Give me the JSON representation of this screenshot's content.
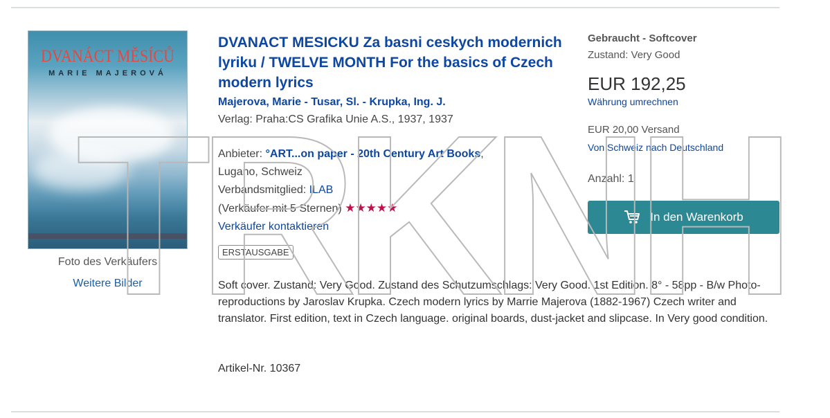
{
  "listing": {
    "cover": {
      "title_text": "DVANÁCT MĚSÍCŮ",
      "author_text": "MARIE MAJEROVÁ"
    },
    "photo_caption": "Foto des Verkäufers",
    "more_images": "Weitere Bilder",
    "title": "DVANACT MESICKU Za basni ceskych modernich lyriku / TWELVE MONTH For the basics of Czech modern lyrics",
    "authors": "Majerova, Marie - Tusar, Sl. - Krupka, Ing. J.",
    "publisher": "Verlag: Praha:CS Grafika Unie A.S., 1937, 1937",
    "seller": {
      "label": "Anbieter: ",
      "name": "°ART...on paper - 20th Century Art Books",
      "location": ", Lugano, Schweiz",
      "member_label": "Verbandsmitglied: ",
      "member_value": "ILAB",
      "rating_text": "(Verkäufer mit 5 Sternen)",
      "stars": "★★★★★",
      "contact": "Verkäufer kontaktieren"
    },
    "badge": "ERSTAUSGABE",
    "description": "Soft cover. Zustand: Very Good. Zustand des Schutzumschlags: Very Good. 1st Edition. 8° - 58pp - B/w Photo-reproductions by Jaroslav Krupka. Czech modern lyrics by Marrie Majerova (1882-1967) Czech writer and translator. First edition, text in Czech language. original boards, dust-jacket and slipcase. In Very good condition.",
    "article_no": "Artikel-Nr. 10367"
  },
  "purchase": {
    "condition_title": "Gebraucht - Softcover",
    "condition_state": "Zustand: Very Good",
    "price": "EUR 192,25",
    "convert_currency": "Währung umrechnen",
    "shipping": "EUR 20,00 Versand",
    "shipping_route": "Von Schweiz nach Deutschland",
    "quantity": "Anzahl: 1",
    "cart_button": "In den Warenkorb",
    "cart_icon": "cart-icon"
  },
  "watermark": {
    "text": "TRKNH"
  },
  "colors": {
    "link": "#0d47a1",
    "button": "#2c8893",
    "stars": "#c0124a",
    "rule": "#d9dee0"
  }
}
